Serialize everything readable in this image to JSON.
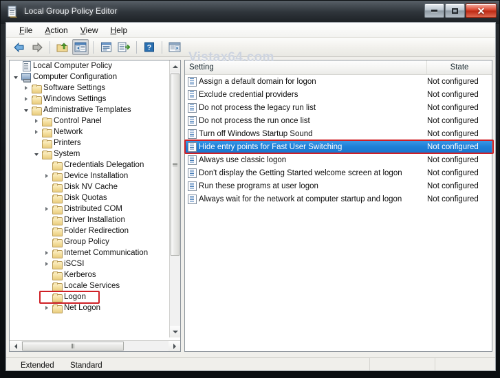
{
  "window": {
    "title": "Local Group Policy Editor",
    "icon": "console-document-icon",
    "controls": {
      "minimize": "–",
      "maximize": "□",
      "close": "✕"
    }
  },
  "watermark": "Vistax64.com",
  "menubar": [
    {
      "name": "file",
      "pre": "",
      "accel": "F",
      "post": "ile"
    },
    {
      "name": "action",
      "pre": "",
      "accel": "A",
      "post": "ction"
    },
    {
      "name": "view",
      "pre": "",
      "accel": "V",
      "post": "iew"
    },
    {
      "name": "help",
      "pre": "",
      "accel": "H",
      "post": "elp"
    }
  ],
  "toolbar": {
    "buttons": [
      {
        "name": "back-button",
        "icon": "left-arrow-icon",
        "pressed": false
      },
      {
        "name": "forward-button",
        "icon": "right-arrow-icon",
        "pressed": false
      },
      {
        "name": "separator-1",
        "icon": "separator",
        "pressed": false
      },
      {
        "name": "up-one-level-button",
        "icon": "folder-up-icon",
        "pressed": false
      },
      {
        "name": "show-hide-console-tree-button",
        "icon": "console-tree-icon",
        "pressed": true
      },
      {
        "name": "separator-2",
        "icon": "separator",
        "pressed": false
      },
      {
        "name": "properties-button",
        "icon": "properties-window-icon",
        "pressed": false
      },
      {
        "name": "export-list-button",
        "icon": "export-list-icon",
        "pressed": false
      },
      {
        "name": "separator-3",
        "icon": "separator",
        "pressed": false
      },
      {
        "name": "help-button",
        "icon": "question-mark-icon",
        "pressed": false
      },
      {
        "name": "separator-4",
        "icon": "separator",
        "pressed": false
      },
      {
        "name": "filter-button",
        "icon": "console-play-icon",
        "pressed": false
      }
    ]
  },
  "tree": {
    "nodes": [
      {
        "label": "Local Computer Policy",
        "depth": 0,
        "twist": "none",
        "icon": "policy-icon",
        "highlight": false
      },
      {
        "label": "Computer Configuration",
        "depth": 0,
        "twist": "expanded",
        "icon": "computer-icon",
        "highlight": false
      },
      {
        "label": "Software Settings",
        "depth": 1,
        "twist": "collapsed",
        "icon": "folder-icon",
        "highlight": false
      },
      {
        "label": "Windows Settings",
        "depth": 1,
        "twist": "collapsed",
        "icon": "folder-icon",
        "highlight": false
      },
      {
        "label": "Administrative Templates",
        "depth": 1,
        "twist": "expanded",
        "icon": "folder-icon",
        "highlight": false
      },
      {
        "label": "Control Panel",
        "depth": 2,
        "twist": "collapsed",
        "icon": "folder-icon",
        "highlight": false
      },
      {
        "label": "Network",
        "depth": 2,
        "twist": "collapsed",
        "icon": "folder-icon",
        "highlight": false
      },
      {
        "label": "Printers",
        "depth": 2,
        "twist": "none",
        "icon": "folder-icon",
        "highlight": false
      },
      {
        "label": "System",
        "depth": 2,
        "twist": "expanded",
        "icon": "folder-icon",
        "highlight": false
      },
      {
        "label": "Credentials Delegation",
        "depth": 3,
        "twist": "none",
        "icon": "folder-icon",
        "highlight": false
      },
      {
        "label": "Device Installation",
        "depth": 3,
        "twist": "collapsed",
        "icon": "folder-icon",
        "highlight": false
      },
      {
        "label": "Disk NV Cache",
        "depth": 3,
        "twist": "none",
        "icon": "folder-icon",
        "highlight": false
      },
      {
        "label": "Disk Quotas",
        "depth": 3,
        "twist": "none",
        "icon": "folder-icon",
        "highlight": false
      },
      {
        "label": "Distributed COM",
        "depth": 3,
        "twist": "collapsed",
        "icon": "folder-icon",
        "highlight": false
      },
      {
        "label": "Driver Installation",
        "depth": 3,
        "twist": "none",
        "icon": "folder-icon",
        "highlight": false
      },
      {
        "label": "Folder Redirection",
        "depth": 3,
        "twist": "none",
        "icon": "folder-icon",
        "highlight": false
      },
      {
        "label": "Group Policy",
        "depth": 3,
        "twist": "none",
        "icon": "folder-icon",
        "highlight": false
      },
      {
        "label": "Internet Communication",
        "depth": 3,
        "twist": "collapsed",
        "icon": "folder-icon",
        "highlight": false
      },
      {
        "label": "iSCSI",
        "depth": 3,
        "twist": "collapsed",
        "icon": "folder-icon",
        "highlight": false
      },
      {
        "label": "Kerberos",
        "depth": 3,
        "twist": "none",
        "icon": "folder-icon",
        "highlight": false
      },
      {
        "label": "Locale Services",
        "depth": 3,
        "twist": "none",
        "icon": "folder-icon",
        "highlight": false
      },
      {
        "label": "Logon",
        "depth": 3,
        "twist": "none",
        "icon": "folder-icon",
        "highlight": true
      },
      {
        "label": "Net Logon",
        "depth": 3,
        "twist": "collapsed",
        "icon": "folder-icon",
        "highlight": false
      }
    ]
  },
  "list": {
    "columns": [
      {
        "name": "setting-column",
        "label": "Setting"
      },
      {
        "name": "state-column",
        "label": "State"
      }
    ],
    "rows": [
      {
        "setting": "Assign a default domain for logon",
        "state": "Not configured",
        "selected": false
      },
      {
        "setting": "Exclude credential providers",
        "state": "Not configured",
        "selected": false
      },
      {
        "setting": "Do not process the legacy run list",
        "state": "Not configured",
        "selected": false
      },
      {
        "setting": "Do not process the run once list",
        "state": "Not configured",
        "selected": false
      },
      {
        "setting": "Turn off Windows Startup Sound",
        "state": "Not configured",
        "selected": false
      },
      {
        "setting": "Hide entry points for Fast User Switching",
        "state": "Not configured",
        "selected": true
      },
      {
        "setting": "Always use classic logon",
        "state": "Not configured",
        "selected": false
      },
      {
        "setting": "Don't display the Getting Started welcome screen at logon",
        "state": "Not configured",
        "selected": false
      },
      {
        "setting": "Run these programs at user logon",
        "state": "Not configured",
        "selected": false
      },
      {
        "setting": "Always wait for the network at computer startup and logon",
        "state": "Not configured",
        "selected": false
      }
    ]
  },
  "tabs": [
    {
      "name": "tab-extended",
      "label": "Extended",
      "active": false
    },
    {
      "name": "tab-standard",
      "label": "Standard",
      "active": true
    }
  ],
  "statusbar": {
    "text": ""
  },
  "colors": {
    "selection_blue": "#1f7fd6",
    "annotation_red": "#cf1f25",
    "folder_yellow": "#f3dd9b",
    "close_button_red": "#bd2b15"
  }
}
